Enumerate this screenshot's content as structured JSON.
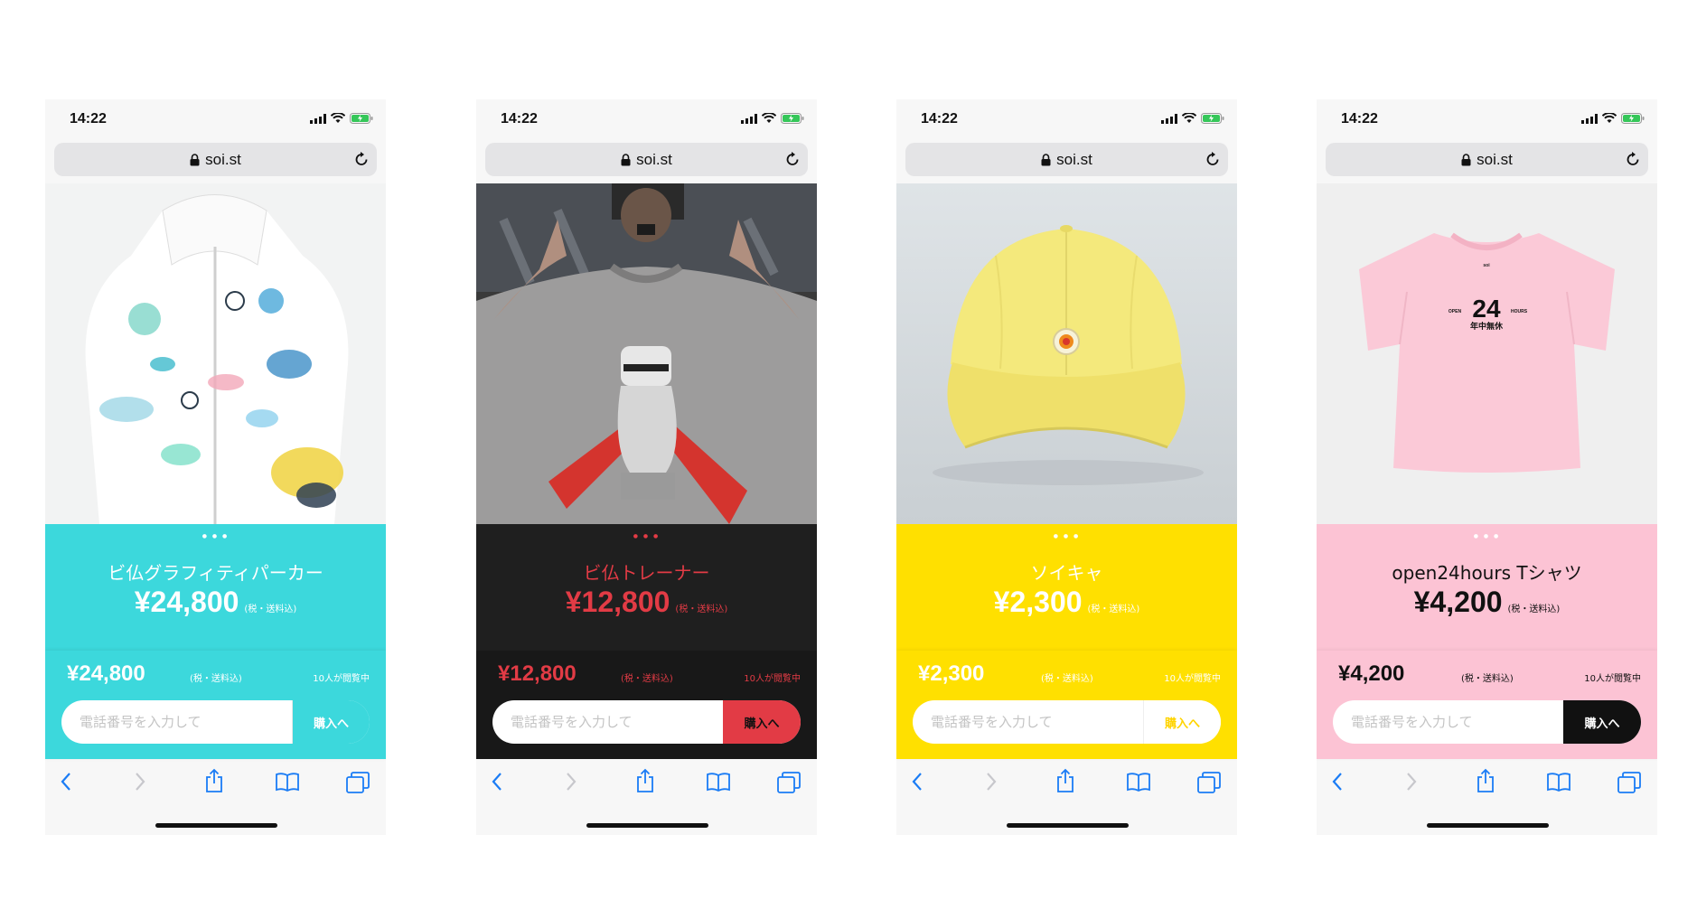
{
  "status": {
    "time": "14:22"
  },
  "browser": {
    "url": "soi.st"
  },
  "products": [
    {
      "id": "hoodie",
      "name": "ビ仏グラフィティパーカー",
      "price": "¥24,800",
      "tax_note": "(税・送料込)",
      "viewers": "10人が閲覧中",
      "phone_placeholder": "電話番号を入力して",
      "buy_label": "購入へ",
      "colors": {
        "bg": "#3cd8dc",
        "bar": "#3cd8dc",
        "text": "#ffffff",
        "btn_bg": "#3cd8dc",
        "btn_text": "#ffffff",
        "dots": "#ffffff"
      }
    },
    {
      "id": "trainer",
      "name": "ビ仏トレーナー",
      "price": "¥12,800",
      "tax_note": "(税・送料込)",
      "viewers": "10人が閲覧中",
      "phone_placeholder": "電話番号を入力して",
      "buy_label": "購入へ",
      "colors": {
        "bg": "#1f1f1f",
        "bar": "#181818",
        "text": "#e23b45",
        "btn_bg": "#e23b45",
        "btn_text": "#111111",
        "dots": "#e23b45"
      }
    },
    {
      "id": "cap",
      "name": "ソイキャ",
      "price": "¥2,300",
      "tax_note": "(税・送料込)",
      "viewers": "10人が閲覧中",
      "phone_placeholder": "電話番号を入力して",
      "buy_label": "購入へ",
      "colors": {
        "bg": "#ffe000",
        "bar": "#ffe000",
        "text": "#ffffff",
        "btn_bg": "#ffffff",
        "btn_text": "#ffd400",
        "dots": "#ffffff"
      }
    },
    {
      "id": "tshirt",
      "name": "open24hours Tシャツ",
      "price": "¥4,200",
      "tax_note": "(税・送料込)",
      "viewers": "10人が閲覧中",
      "phone_placeholder": "電話番号を入力して",
      "buy_label": "購入へ",
      "colors": {
        "bg": "#fcc3d4",
        "bar": "#fcc3d4",
        "text": "#111111",
        "btn_bg": "#111111",
        "btn_text": "#ffffff",
        "dots": "#ffffff"
      }
    }
  ],
  "print_text": {
    "open": "OPEN",
    "hours": "HOURS",
    "num": "24",
    "jp": "年中無休",
    "brand": "soi"
  },
  "icons": [
    "signal-icon",
    "wifi-icon",
    "battery-icon",
    "lock-icon",
    "reload-icon",
    "back-icon",
    "forward-icon",
    "share-icon",
    "bookmarks-icon",
    "tabs-icon"
  ],
  "accent_colors": {
    "link_blue": "#1a7cf5",
    "disabled": "#c7c7cc"
  }
}
